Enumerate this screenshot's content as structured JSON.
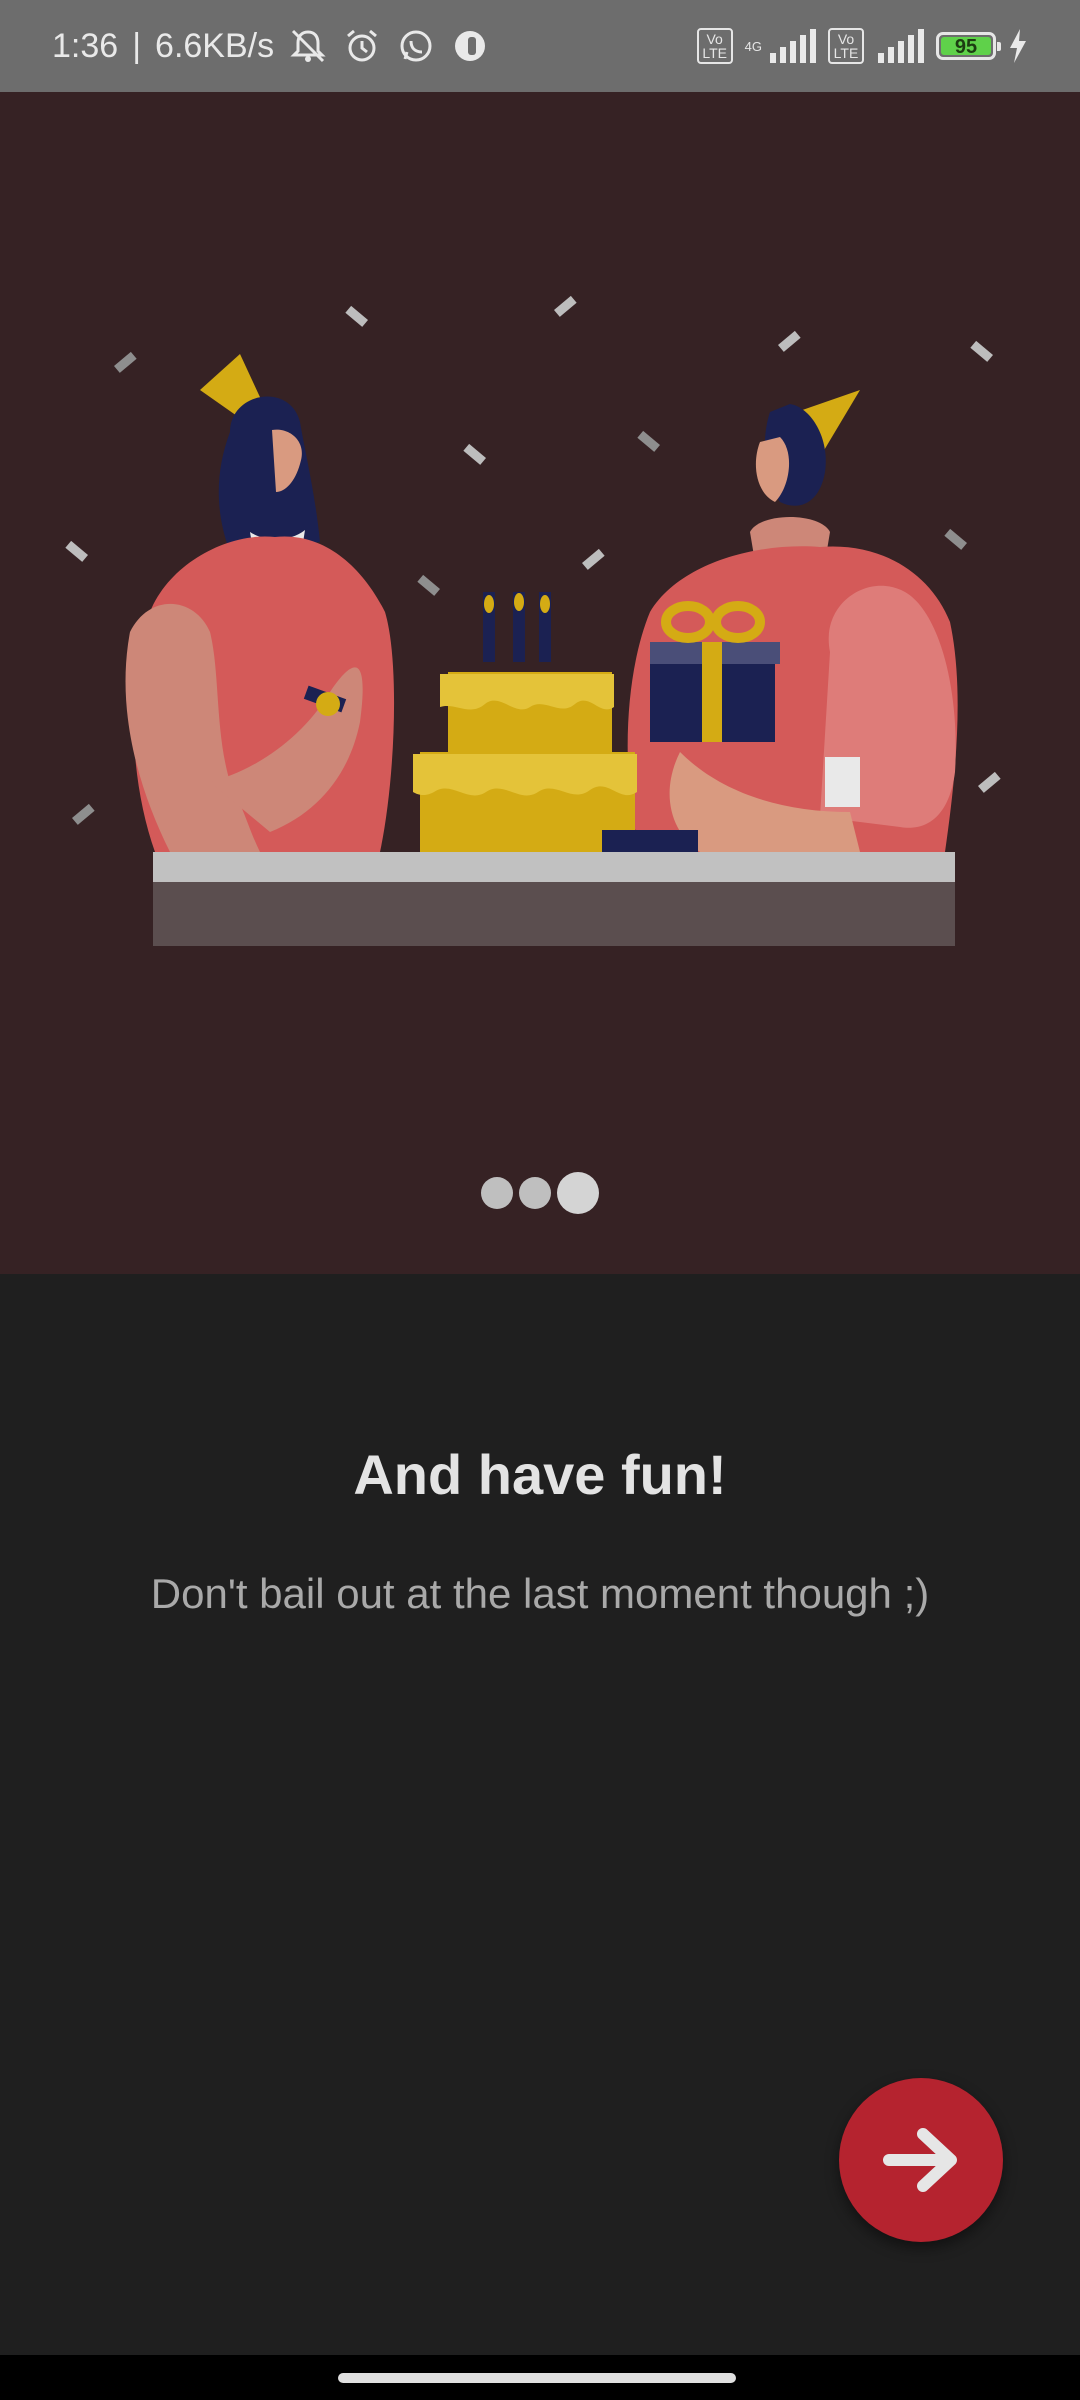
{
  "status_bar": {
    "time": "1:36",
    "network_speed": "6.6KB/s",
    "left_icons": [
      "mute-icon",
      "alarm-icon",
      "whatsapp-icon",
      "app-icon"
    ],
    "volte_label_1": "Vo LTE",
    "net_type": "4G",
    "volte_label_2": "Vo LTE",
    "battery_level": "95",
    "charging": true
  },
  "carousel": {
    "illustration": "birthday-party-illustration",
    "page_count": 3,
    "current_page": 3
  },
  "content": {
    "title": "And have fun!",
    "subtitle": "Don't bail out at the last moment though ;)"
  },
  "fab": {
    "icon": "arrow-right-icon",
    "color": "#b5232f"
  },
  "colors": {
    "hero_bg": "#362224",
    "page_bg": "#1f1f1f",
    "accent": "#b5232f"
  }
}
